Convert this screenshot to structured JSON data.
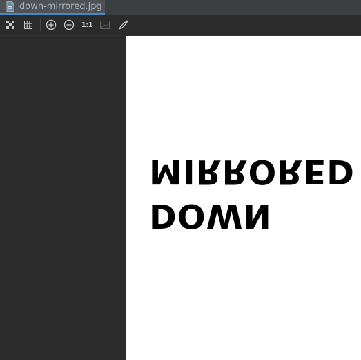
{
  "tab": {
    "file_name": "down-mirrored.jpg",
    "close_glyph": "✕",
    "file_icon": "image-file-icon"
  },
  "toolbar": {
    "buttons": [
      {
        "icon": "fit-to-window-icon"
      },
      {
        "icon": "grid-icon"
      },
      {
        "icon": "zoom-in-icon"
      },
      {
        "icon": "zoom-out-icon"
      },
      {
        "label": "1:1"
      },
      {
        "icon": "background-icon"
      },
      {
        "icon": "color-picker-icon"
      }
    ]
  },
  "image": {
    "line1": "MIRRORED",
    "line2": "DOWN"
  },
  "colors": {
    "tab_accent": "#4a88c7",
    "background": "#2b2b2b",
    "image_bg": "#ffffff"
  }
}
